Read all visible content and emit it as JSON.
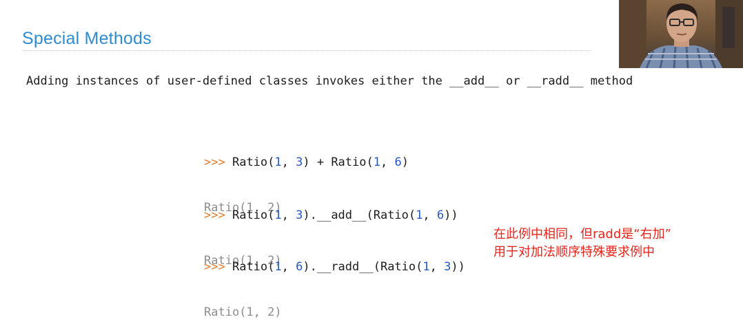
{
  "slide": {
    "title": "Special Methods",
    "intro": "Adding instances of user-defined classes invokes either the __add__ or __radd__ method"
  },
  "examples": [
    {
      "prompt": ">>>",
      "input_parts": [
        "Ratio(",
        "1",
        ", ",
        "3",
        ") + Ratio(",
        "1",
        ", ",
        "6",
        ")"
      ],
      "output": "Ratio(1, 2)"
    },
    {
      "prompt": ">>>",
      "input_parts": [
        "Ratio(",
        "1",
        ", ",
        "3",
        ").__add__(Ratio(",
        "1",
        ", ",
        "6",
        "))"
      ],
      "output": "Ratio(1, 2)"
    },
    {
      "prompt": ">>>",
      "input_parts": [
        "Ratio(",
        "1",
        ", ",
        "6",
        ").__radd__(Ratio(",
        "1",
        ", ",
        "3",
        "))"
      ],
      "output": "Ratio(1, 2)"
    }
  ],
  "subtitle": {
    "line1": "在此例中相同，但radd是“右加”",
    "line2": "用于对加法顺序特殊要求例中",
    "color": "#e8231a"
  },
  "colors": {
    "title": "#2e8bcf",
    "prompt": "#e07b2a",
    "number": "#2457c5",
    "output": "#8d8d8d"
  },
  "webcam": {
    "icon": "presenter-video-icon"
  }
}
